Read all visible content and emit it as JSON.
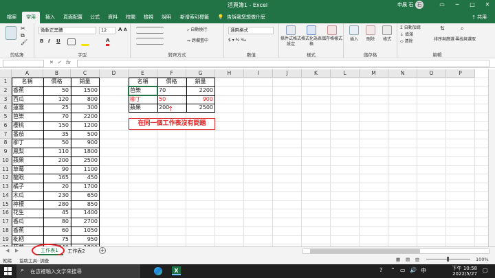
{
  "window": {
    "title": "活頁簿1 - Excel",
    "user": "申展 石",
    "avatar": "石",
    "minimize": "─",
    "restore": "□",
    "close": "✕"
  },
  "menu": {
    "file": "檔案",
    "home": "常用",
    "insert": "插入",
    "layout": "頁面配置",
    "formulas": "公式",
    "data": "資料",
    "review": "校閱",
    "view": "檢視",
    "help": "說明",
    "newtab": "新增索引標籤",
    "search": "告訴我您想做什麼",
    "share": "共用"
  },
  "ribbon": {
    "clipboard": "剪貼簿",
    "font": "字型",
    "alignment": "對齊方式",
    "number": "數值",
    "styles": "樣式",
    "cells": "儲存格",
    "editing": "編輯",
    "font_name": "微軟正黑體",
    "font_size": "12",
    "wrap": "自動換行",
    "merge": "跨欄置中",
    "number_format": "通用格式",
    "cond_format": "條件式格式設定",
    "format_table": "格式化為表格",
    "cell_styles": "儲存格樣式",
    "insert": "插入",
    "delete": "刪除",
    "format": "格式",
    "autosum": "自動加總",
    "fill": "填滿",
    "clear": "清除",
    "sort": "排序與篩選",
    "find": "尋找與選取",
    "bold": "B",
    "italic": "I",
    "underline": "U",
    "font_color_letter": "A"
  },
  "formula_bar": {
    "name_box": "",
    "fx": "fx"
  },
  "columns": [
    "A",
    "B",
    "C",
    "D",
    "E",
    "F",
    "G",
    "H",
    "I",
    "J",
    "K",
    "L",
    "M",
    "N",
    "O",
    "P"
  ],
  "rows": [
    "1",
    "2",
    "3",
    "4",
    "5",
    "6",
    "7",
    "8",
    "9",
    "10",
    "11",
    "12",
    "13",
    "14",
    "15",
    "16",
    "17",
    "18",
    "19",
    "20",
    "21",
    "22"
  ],
  "table1": {
    "headers": [
      "名稱",
      "價格",
      "銷量"
    ],
    "rows": [
      [
        "香蕉",
        "50",
        "1500"
      ],
      [
        "西瓜",
        "120",
        "800"
      ],
      [
        "蓮霧",
        "25",
        "300"
      ],
      [
        "芭樂",
        "70",
        "2200"
      ],
      [
        "櫻桃",
        "150",
        "1200"
      ],
      [
        "番茄",
        "35",
        "500"
      ],
      [
        "柳丁",
        "50",
        "900"
      ],
      [
        "鳳梨",
        "110",
        "1800"
      ],
      [
        "蘋果",
        "200",
        "2500"
      ],
      [
        "草莓",
        "90",
        "1100"
      ],
      [
        "龍眼",
        "165",
        "450"
      ],
      [
        "橘子",
        "20",
        "1700"
      ],
      [
        "木瓜",
        "230",
        "650"
      ],
      [
        "檸檬",
        "280",
        "850"
      ],
      [
        "花生",
        "45",
        "1400"
      ],
      [
        "香瓜",
        "80",
        "2700"
      ],
      [
        "香蕉",
        "60",
        "1050"
      ],
      [
        "枇杷",
        "75",
        "950"
      ],
      [
        "葡萄",
        "240",
        "1800"
      ]
    ]
  },
  "table2": {
    "headers": [
      "名稱",
      "價格",
      "銷量"
    ],
    "rows": [
      [
        "芭樂",
        "70",
        "2200"
      ],
      [
        "柳丁",
        "50",
        "900"
      ],
      [
        "蘋果",
        "200",
        "2500"
      ]
    ]
  },
  "annotation": {
    "arrow": "↑",
    "text": "在同一個工作表沒有問題"
  },
  "sheets": {
    "tab1": "工作表1",
    "tab2": "工作表2",
    "add": "+"
  },
  "status": {
    "ready": "就緒",
    "accessibility": "協助工具: 調查",
    "zoom": "100%"
  },
  "taskbar": {
    "search_placeholder": "在這裡輸入文字來搜尋",
    "time": "下午 10:58",
    "date": "2022/5/27",
    "ime": "中"
  },
  "colors": {
    "excel_green": "#217346",
    "red": "#e02020",
    "grid": "#e1e1e1"
  }
}
